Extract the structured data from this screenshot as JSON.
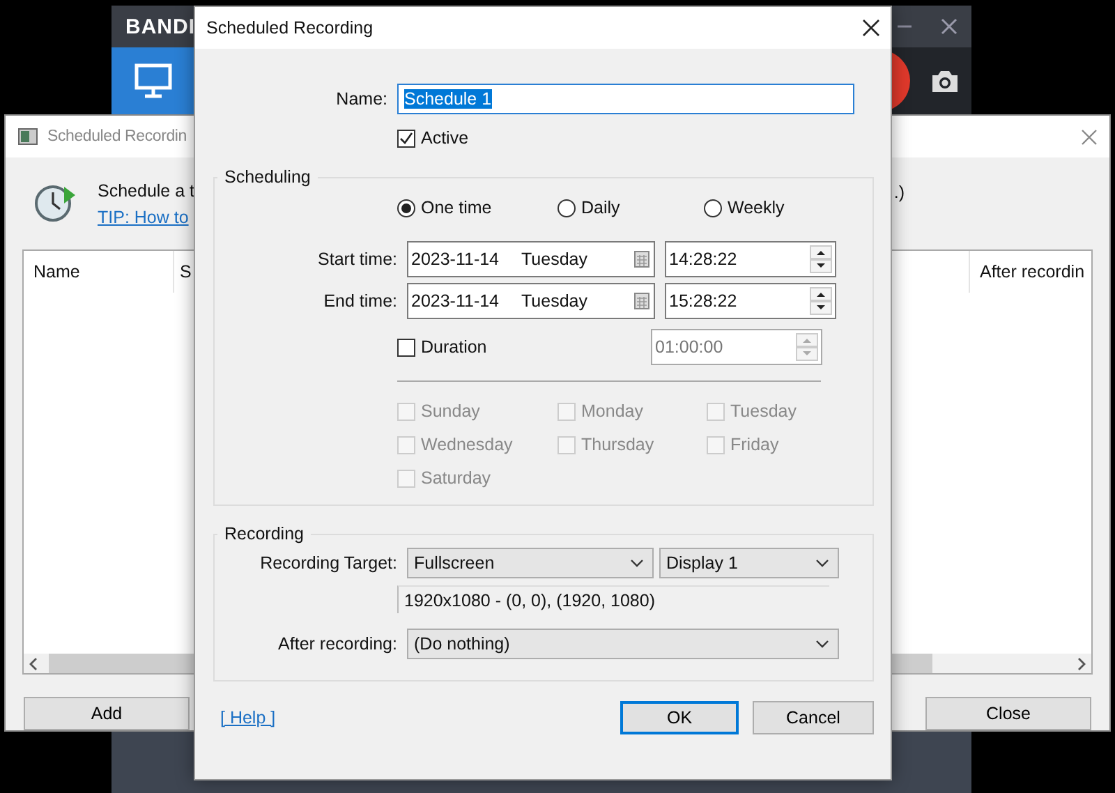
{
  "app_window": {
    "title": "BANDI"
  },
  "back_window": {
    "title": "Scheduled Recordin",
    "intro": "Schedule a t",
    "tip_link": "TIP: How to",
    "intro_end": ".)",
    "columns": [
      "Name",
      "S",
      "After recordin"
    ],
    "buttons": [
      "Add",
      "Close"
    ]
  },
  "dialog": {
    "title": "Scheduled Recording",
    "name_label": "Name:",
    "name_value": "Schedule 1",
    "name_selected": true,
    "active": {
      "label": "Active",
      "checked": true
    },
    "scheduling": {
      "title": "Scheduling",
      "frequency": [
        {
          "label": "One time",
          "selected": true
        },
        {
          "label": "Daily",
          "selected": false
        },
        {
          "label": "Weekly",
          "selected": false
        }
      ],
      "start": {
        "label": "Start time:",
        "date": "2023-11-14",
        "weekday": "Tuesday",
        "time": "14:28:22"
      },
      "end": {
        "label": "End time:",
        "date": "2023-11-14",
        "weekday": "Tuesday",
        "time": "15:28:22"
      },
      "duration": {
        "label": "Duration",
        "checked": false,
        "value": "01:00:00",
        "disabled": true
      },
      "days": [
        {
          "label": "Sunday",
          "checked": false,
          "disabled": true
        },
        {
          "label": "Monday",
          "checked": false,
          "disabled": true
        },
        {
          "label": "Tuesday",
          "checked": false,
          "disabled": true
        },
        {
          "label": "Wednesday",
          "checked": false,
          "disabled": true
        },
        {
          "label": "Thursday",
          "checked": false,
          "disabled": true
        },
        {
          "label": "Friday",
          "checked": false,
          "disabled": true
        },
        {
          "label": "Saturday",
          "checked": false,
          "disabled": true
        }
      ]
    },
    "recording": {
      "title": "Recording",
      "target_label": "Recording Target:",
      "target": "Fullscreen",
      "display": "Display 1",
      "area": "1920x1080 - (0, 0), (1920, 1080)",
      "after_label": "After recording:",
      "after": "(Do nothing)"
    },
    "help_link": "[ Help ]",
    "buttons": [
      {
        "label": "OK",
        "default": true
      },
      {
        "label": "Cancel",
        "default": false
      }
    ]
  }
}
